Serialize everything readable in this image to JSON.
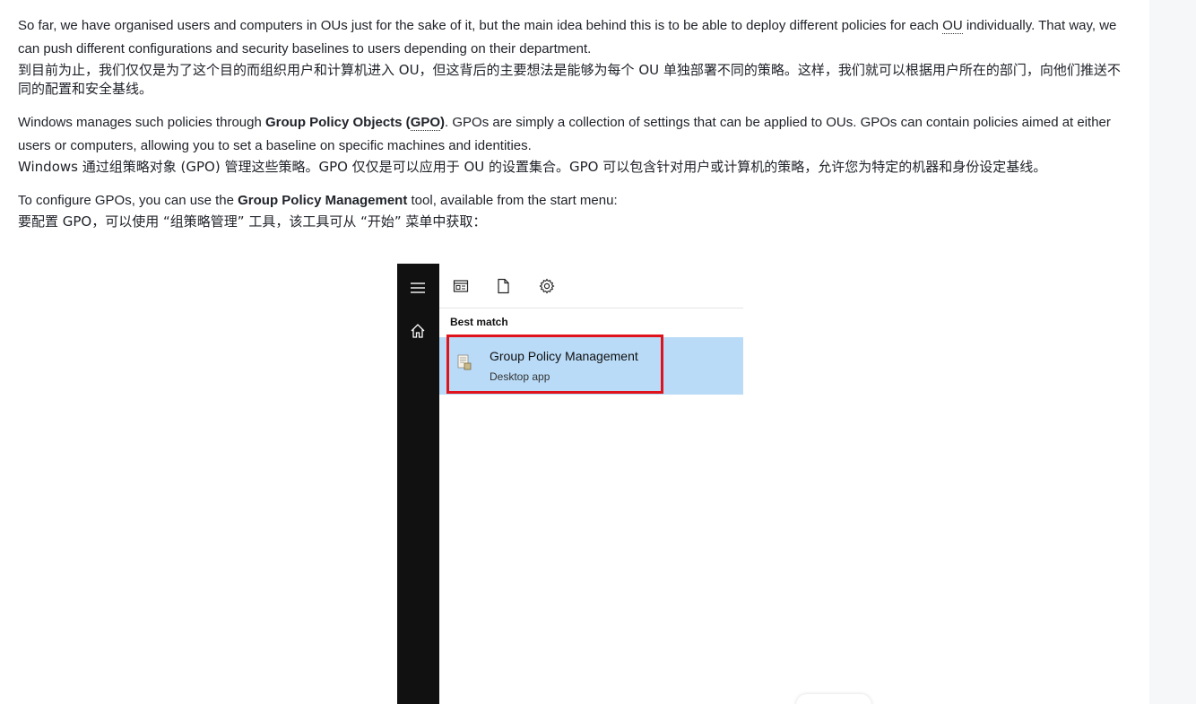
{
  "paragraphs": {
    "p1": {
      "en_a": "So far, we have organised users and computers in OUs just for the sake of it, but the main idea behind this is to be able to deploy different policies for each ",
      "en_abbr": "OU",
      "en_b": " individually. That way, we can push different configurations and security baselines to users depending on their department.",
      "zh": "到目前为止，我们仅仅是为了这个目的而组织用户和计算机进入 OU，但这背后的主要想法是能够为每个 OU 单独部署不同的策略。这样，我们就可以根据用户所在的部门，向他们推送不同的配置和安全基线。"
    },
    "p2": {
      "en_a": "Windows manages such policies through ",
      "en_bold": "Group Policy Objects (",
      "en_abbr": "GPO",
      "en_bold_end": ")",
      "en_b": ". GPOs are simply a collection of settings that can be applied to OUs. GPOs can contain policies aimed at either users or computers, allowing you to set a baseline on specific machines and identities.",
      "zh": "Windows 通过组策略对象 (GPO) 管理这些策略。GPO 仅仅是可以应用于 OU 的设置集合。GPO 可以包含针对用户或计算机的策略，允许您为特定的机器和身份设定基线。"
    },
    "p3": {
      "en_a": "To configure GPOs, you can use the ",
      "en_bold": "Group Policy Management",
      "en_b": " tool, available from the start menu:",
      "zh": "要配置 GPO，可以使用 “组策略管理” 工具，该工具可从 “开始” 菜单中获取："
    }
  },
  "startmenu": {
    "section_label": "Best match",
    "result_name": "Group Policy Management",
    "result_type": "Desktop app",
    "rail_icons": [
      "hamburger-menu-icon",
      "home-icon"
    ],
    "top_icons": [
      "apps-icon",
      "document-icon",
      "gear-icon"
    ],
    "highlight_color": "#e0121b",
    "selection_color": "#b9dbf7"
  }
}
